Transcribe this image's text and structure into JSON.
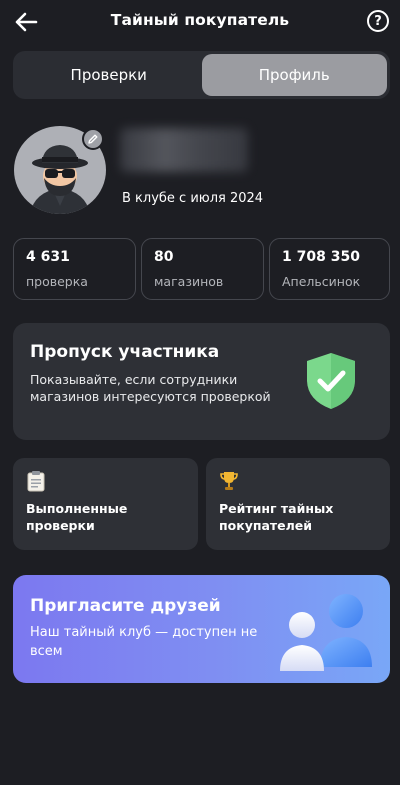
{
  "header": {
    "title": "Тайный покупатель",
    "help_glyph": "?"
  },
  "tabs": [
    {
      "label": "Проверки",
      "active": false
    },
    {
      "label": "Профиль",
      "active": true
    }
  ],
  "profile": {
    "member_since": "В клубе с июля 2024"
  },
  "stats": [
    {
      "value": "4 631",
      "label": "проверка"
    },
    {
      "value": "80",
      "label": "магазинов"
    },
    {
      "value": "1 708 350",
      "label": "Апельсинок"
    }
  ],
  "pass_card": {
    "title": "Пропуск участника",
    "description": "Показывайте, если сотрудники магазинов интересуются проверкой"
  },
  "tiles": [
    {
      "label": "Выполненные проверки",
      "icon": "clipboard-icon"
    },
    {
      "label": "Рейтинг тайных покупателей",
      "icon": "trophy-icon"
    }
  ],
  "invite": {
    "title": "Пригласите друзей",
    "description": "Наш тайный клуб — доступен не всем"
  },
  "colors": {
    "background": "#1d1e23",
    "card": "#2e3036",
    "active_tab": "#9b9ca1",
    "shield_green": "#7bd88c",
    "invite_gradient_start": "#7c78f0",
    "invite_gradient_end": "#79a7f7"
  }
}
